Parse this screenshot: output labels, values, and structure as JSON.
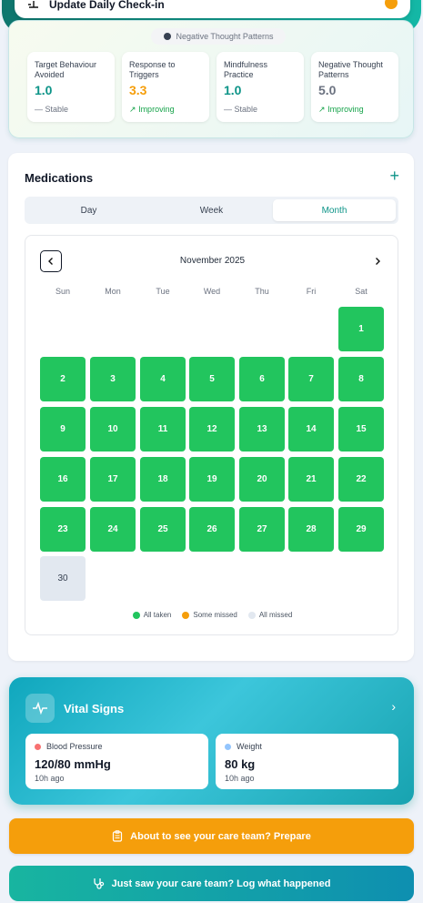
{
  "header": {
    "checkin_title": "Update Daily Check-in"
  },
  "metrics": {
    "pill": "Negative Thought Patterns",
    "items": [
      {
        "label": "Target Behaviour Avoided",
        "value": "1.0",
        "trend": "Stable",
        "trend_icon": "—"
      },
      {
        "label": "Response to Triggers",
        "value": "3.3",
        "trend": "Improving",
        "trend_icon": "↗"
      },
      {
        "label": "Mindfulness Practice",
        "value": "1.0",
        "trend": "Stable",
        "trend_icon": "—"
      },
      {
        "label": "Negative Thought Patterns",
        "value": "5.0",
        "trend": "Improving",
        "trend_icon": "↗"
      }
    ]
  },
  "medications": {
    "title": "Medications",
    "add_icon": "+",
    "tabs": [
      "Day",
      "Week",
      "Month"
    ],
    "active_tab": "Month",
    "calendar": {
      "month": "November 2025",
      "prev_icon": "‹",
      "next_icon": "›",
      "weekdays": [
        "Sun",
        "Mon",
        "Tue",
        "Wed",
        "Thu",
        "Fri",
        "Sat"
      ],
      "days": [
        "1",
        "2",
        "3",
        "4",
        "5",
        "6",
        "7",
        "8",
        "9",
        "10",
        "11",
        "12",
        "13",
        "14",
        "15",
        "16",
        "17",
        "18",
        "19",
        "20",
        "21",
        "22",
        "23",
        "24",
        "25",
        "26",
        "27",
        "28",
        "29",
        "30"
      ],
      "missed_days": [
        "30"
      ]
    },
    "legend": [
      {
        "label": "All taken",
        "color": "#22c55e"
      },
      {
        "label": "Some missed",
        "color": "#f59e0b"
      },
      {
        "label": "All missed",
        "color": "#e2e8f0"
      }
    ]
  },
  "vitals": {
    "title": "Vital Signs",
    "chevron": "›",
    "items": [
      {
        "label": "Blood Pressure",
        "value": "120/80 mmHg",
        "time": "10h ago",
        "color": "#f87171"
      },
      {
        "label": "Weight",
        "value": "80 kg",
        "time": "10h ago",
        "color": "#93c5fd"
      }
    ]
  },
  "actions": {
    "prepare": "About to see your care team? Prepare",
    "log": "Just saw your care team? Log what happened"
  }
}
